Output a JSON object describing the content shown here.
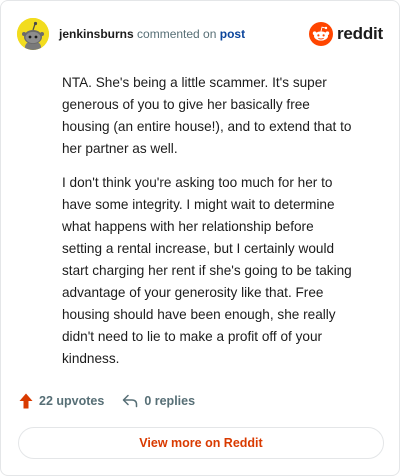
{
  "header": {
    "username": "jenkinsburns",
    "action_text": "commented on",
    "post_link": "post",
    "brand_name": "reddit"
  },
  "comment": {
    "paragraphs": [
      "NTA. She's being a little scammer. It's super generous of you to give her basically free housing (an entire house!), and to extend that to her partner as well.",
      "I don't think you're asking too much for her to have some integrity. I might wait to determine what happens with her relationship before setting a rental increase, but I certainly would start charging her rent if she's going to be taking advantage of your generosity like that. Free housing should have been enough, she really didn't need to lie to make a profit off of your kindness."
    ]
  },
  "actions": {
    "upvotes_label": "22 upvotes",
    "replies_label": "0 replies"
  },
  "cta": {
    "label": "View more on Reddit"
  },
  "icons": {
    "avatar": "snoo-avatar-icon",
    "brand": "reddit-logo-icon",
    "upvote": "upvote-arrow-icon",
    "reply": "reply-arrow-icon"
  },
  "colors": {
    "brand_orange": "#ff4500",
    "upvote_orange": "#d93a00",
    "cta_text": "#d93a00",
    "post_link": "#0a449b",
    "avatar_bg": "#f2dc1e"
  }
}
